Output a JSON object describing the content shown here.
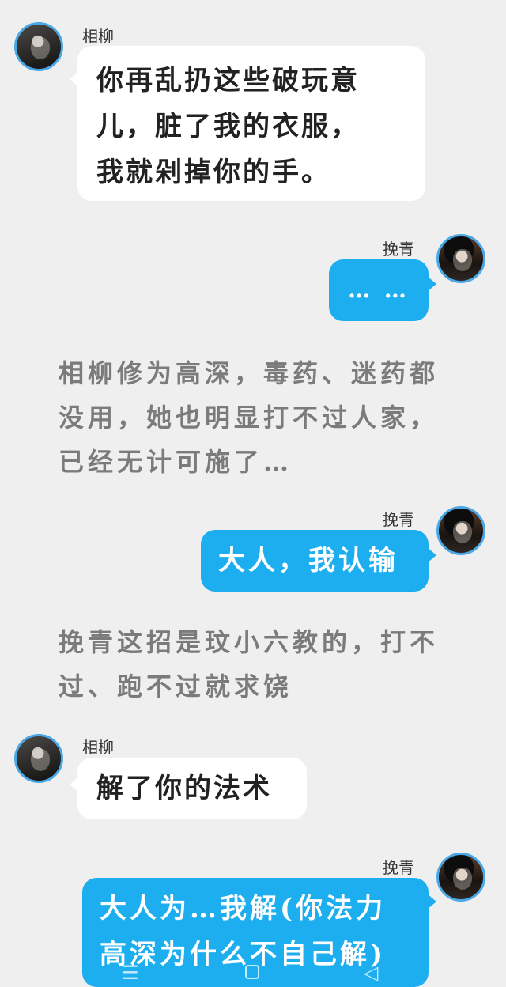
{
  "chat": {
    "messages": [
      {
        "sender": "相柳",
        "side": "left",
        "text_lines": [
          "你再乱扔这些破玩意",
          "儿，脏了我的衣服，",
          "我就剁掉你的手。"
        ]
      },
      {
        "sender": "挽青",
        "side": "right",
        "text": "…  …"
      },
      {
        "type": "narration",
        "text_lines": [
          "相柳修为高深，毒药、迷药都",
          "没用，她也明显打不过人家，",
          "已经无计可施了…"
        ]
      },
      {
        "sender": "挽青",
        "side": "right",
        "text": "大人，我认输"
      },
      {
        "type": "narration",
        "text_lines": [
          "挽青这招是玟小六教的，打不",
          "过、跑不过就求饶"
        ]
      },
      {
        "sender": "相柳",
        "side": "left",
        "text": "解了你的法术"
      },
      {
        "sender": "挽青",
        "side": "right",
        "text_lines": [
          "大人为…我解(你法力",
          "高深为什么不自己解)"
        ]
      }
    ]
  },
  "navigation": {
    "menu_icon": "☰",
    "home_icon": "square-home-icon",
    "back_icon": "◁"
  },
  "colors": {
    "background": "#efefef",
    "blue_bubble": "#1daef0",
    "white_bubble": "#ffffff",
    "narration_text": "#7b7b7b",
    "avatar_ring": "#4aa8e6"
  }
}
